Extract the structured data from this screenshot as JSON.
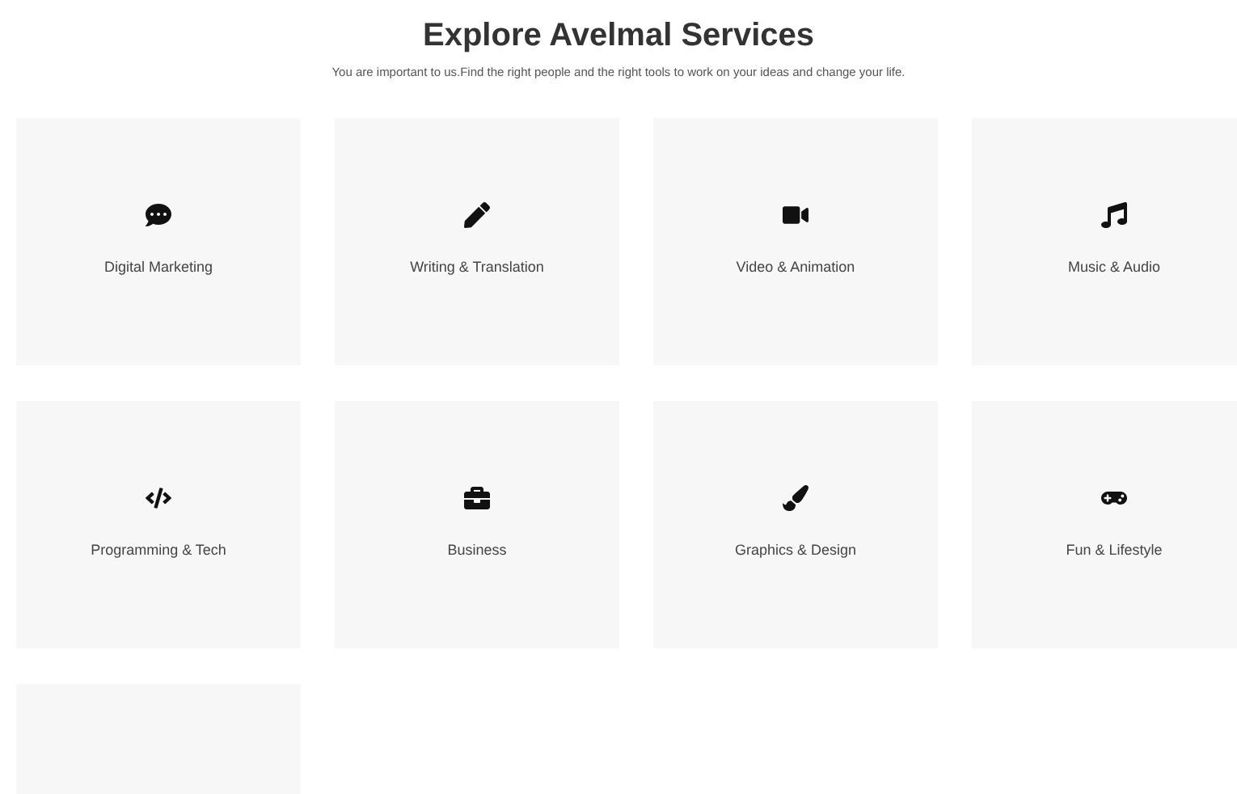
{
  "header": {
    "title": "Explore Avelmal Services",
    "subtitle": "You are important to us.Find the right people and the right tools to work on your ideas and change your life."
  },
  "services": [
    {
      "label": "Digital Marketing"
    },
    {
      "label": "Writing & Translation"
    },
    {
      "label": "Video & Animation"
    },
    {
      "label": "Music & Audio"
    },
    {
      "label": "Programming & Tech"
    },
    {
      "label": "Business"
    },
    {
      "label": "Graphics & Design"
    },
    {
      "label": "Fun & Lifestyle"
    }
  ]
}
